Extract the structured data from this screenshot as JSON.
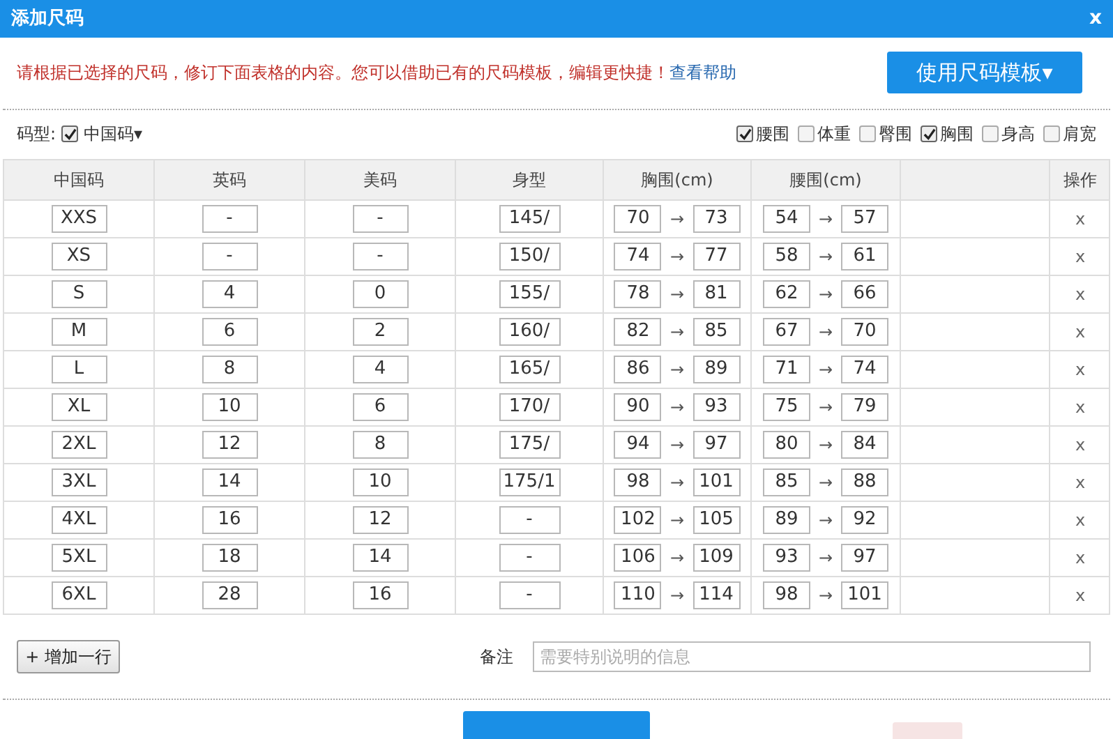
{
  "window": {
    "title": "添加尺码",
    "close": "x"
  },
  "notice": {
    "text": "请根据已选择的尺码，修订下面表格的内容。您可以借助已有的尺码模板，编辑更快捷！",
    "help_link": "查看帮助"
  },
  "template_button": {
    "label": "使用尺码模板",
    "caret": "▾"
  },
  "size_type": {
    "label": "码型:",
    "checked": true,
    "value": "中国码",
    "caret": "▾"
  },
  "measurements": [
    {
      "label": "腰围",
      "checked": true
    },
    {
      "label": "体重",
      "checked": false
    },
    {
      "label": "臀围",
      "checked": false
    },
    {
      "label": "胸围",
      "checked": true
    },
    {
      "label": "身高",
      "checked": false
    },
    {
      "label": "肩宽",
      "checked": false
    }
  ],
  "table": {
    "columns": [
      "中国码",
      "英码",
      "美码",
      "身型",
      "胸围(cm)",
      "腰围(cm)",
      "",
      "操作"
    ],
    "arrow": "→",
    "rows": [
      {
        "cn": "XXS",
        "uk": "-",
        "us": "-",
        "body": "145/",
        "chest": [
          "70",
          "73"
        ],
        "waist": [
          "54",
          "57"
        ],
        "delete": "x"
      },
      {
        "cn": "XS",
        "uk": "-",
        "us": "-",
        "body": "150/",
        "chest": [
          "74",
          "77"
        ],
        "waist": [
          "58",
          "61"
        ],
        "delete": "x"
      },
      {
        "cn": "S",
        "uk": "4",
        "us": "0",
        "body": "155/",
        "chest": [
          "78",
          "81"
        ],
        "waist": [
          "62",
          "66"
        ],
        "delete": "x"
      },
      {
        "cn": "M",
        "uk": "6",
        "us": "2",
        "body": "160/",
        "chest": [
          "82",
          "85"
        ],
        "waist": [
          "67",
          "70"
        ],
        "delete": "x"
      },
      {
        "cn": "L",
        "uk": "8",
        "us": "4",
        "body": "165/",
        "chest": [
          "86",
          "89"
        ],
        "waist": [
          "71",
          "74"
        ],
        "delete": "x"
      },
      {
        "cn": "XL",
        "uk": "10",
        "us": "6",
        "body": "170/",
        "chest": [
          "90",
          "93"
        ],
        "waist": [
          "75",
          "79"
        ],
        "delete": "x"
      },
      {
        "cn": "2XL",
        "uk": "12",
        "us": "8",
        "body": "175/",
        "chest": [
          "94",
          "97"
        ],
        "waist": [
          "80",
          "84"
        ],
        "delete": "x"
      },
      {
        "cn": "3XL",
        "uk": "14",
        "us": "10",
        "body": "175/1",
        "chest": [
          "98",
          "101"
        ],
        "waist": [
          "85",
          "88"
        ],
        "delete": "x"
      },
      {
        "cn": "4XL",
        "uk": "16",
        "us": "12",
        "body": "-",
        "chest": [
          "102",
          "105"
        ],
        "waist": [
          "89",
          "92"
        ],
        "delete": "x"
      },
      {
        "cn": "5XL",
        "uk": "18",
        "us": "14",
        "body": "-",
        "chest": [
          "106",
          "109"
        ],
        "waist": [
          "93",
          "97"
        ],
        "delete": "x"
      },
      {
        "cn": "6XL",
        "uk": "28",
        "us": "16",
        "body": "-",
        "chest": [
          "110",
          "114"
        ],
        "waist": [
          "98",
          "101"
        ],
        "delete": "x"
      }
    ]
  },
  "add_row_button": {
    "label": "+ 增加一行"
  },
  "remark": {
    "label": "备注",
    "placeholder": "需要特别说明的信息"
  }
}
